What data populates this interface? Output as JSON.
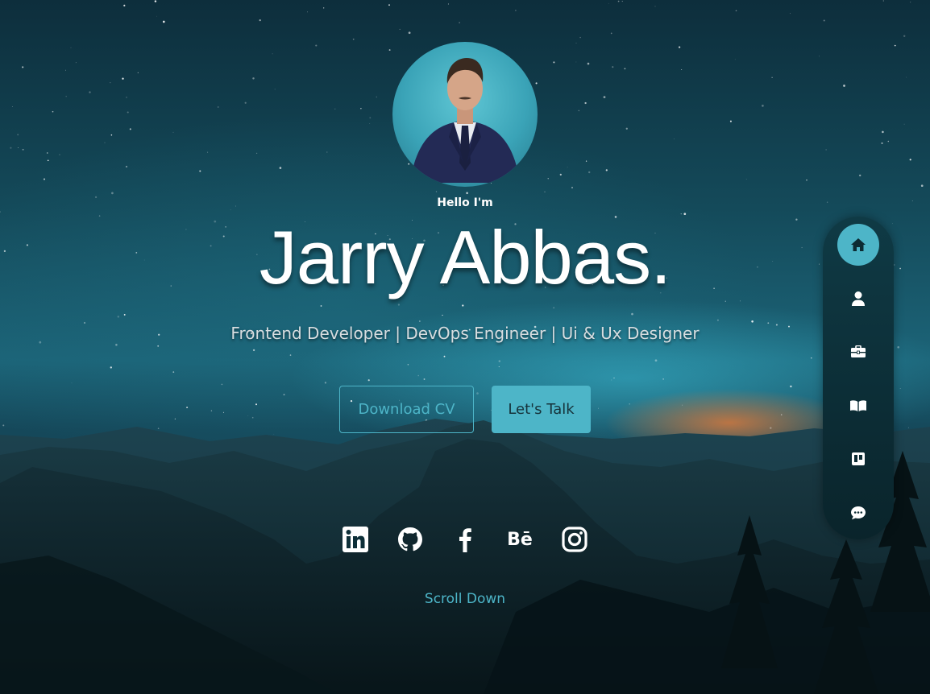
{
  "hero": {
    "greeting": "Hello I'm",
    "name": "Jarry Abbas.",
    "roles": "Frontend Developer | DevOps Engineer | Ui & Ux Designer",
    "download_cv_label": "Download CV",
    "lets_talk_label": "Let's Talk",
    "scroll_label": "Scroll Down"
  },
  "social": [
    {
      "icon": "linkedin-icon"
    },
    {
      "icon": "github-icon"
    },
    {
      "icon": "facebook-icon"
    },
    {
      "icon": "behance-icon",
      "text": "Bē"
    },
    {
      "icon": "instagram-icon"
    }
  ],
  "sidenav": {
    "items": [
      {
        "icon": "home-icon",
        "active": true
      },
      {
        "icon": "user-icon",
        "active": false
      },
      {
        "icon": "briefcase-icon",
        "active": false
      },
      {
        "icon": "book-icon",
        "active": false
      },
      {
        "icon": "trello-icon",
        "active": false
      },
      {
        "icon": "chat-icon",
        "active": false
      }
    ]
  },
  "colors": {
    "accent": "#4db5c8",
    "text": "#ffffff",
    "nav_bg": "#0f3a45"
  }
}
